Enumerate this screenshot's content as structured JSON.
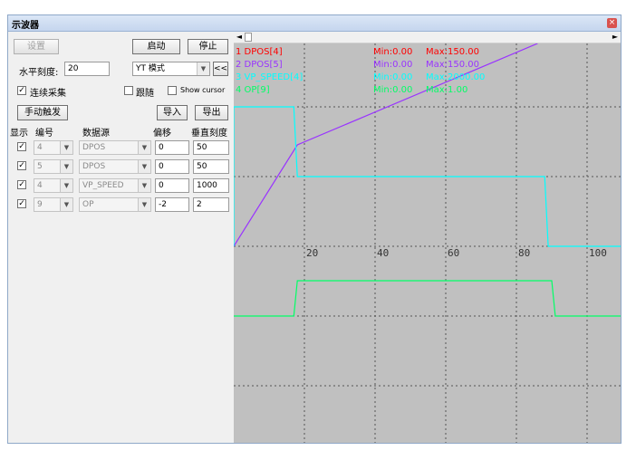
{
  "window": {
    "title": "示波器",
    "close_glyph": "×"
  },
  "toolbar": {
    "settings_label": "设置",
    "start_label": "启动",
    "stop_label": "停止",
    "h_scale_label": "水平刻度:",
    "h_scale_value": "20",
    "mode_value": "YT 模式",
    "collapse_label": "<<",
    "continuous_label": "连续采集",
    "continuous_checked": true,
    "follow_label": "跟随",
    "follow_checked": false,
    "show_cursor_label": "Show cursor",
    "show_cursor_checked": false,
    "manual_trigger_label": "手动触发",
    "import_label": "导入",
    "export_label": "导出"
  },
  "channel_table": {
    "headers": [
      "显示",
      "编号",
      "数据源",
      "偏移",
      "垂直刻度"
    ],
    "rows": [
      {
        "show": true,
        "number": "4",
        "source": "DPOS",
        "offset": "0",
        "scale": "50"
      },
      {
        "show": true,
        "number": "5",
        "source": "DPOS",
        "offset": "0",
        "scale": "50"
      },
      {
        "show": true,
        "number": "4",
        "source": "VP_SPEED",
        "offset": "0",
        "scale": "1000"
      },
      {
        "show": true,
        "number": "9",
        "source": "OP",
        "offset": "-2",
        "scale": "2"
      }
    ]
  },
  "scroll": {
    "left_glyph": "◄",
    "right_glyph": "►"
  },
  "legend": [
    {
      "name": "1 DPOS[4]",
      "min": "Min:0.00",
      "max": "Max:150.00",
      "color": "#ff0000"
    },
    {
      "name": "2 DPOS[5]",
      "min": "Min:0.00",
      "max": "Max:150.00",
      "color": "#9933ff"
    },
    {
      "name": "3 VP_SPEED[4]",
      "min": "Min:0.00",
      "max": "Max:2000.00",
      "color": "#00ffff"
    },
    {
      "name": "4 OP[9]",
      "min": "Min:0.00",
      "max": "Max:1.00",
      "color": "#00ff66"
    }
  ],
  "chart_data": {
    "type": "line",
    "x_ticks": [
      "20",
      "40",
      "60",
      "80",
      "100"
    ],
    "xlim": [
      0,
      100
    ],
    "grid": true,
    "series": [
      {
        "name": "1 DPOS[4]",
        "color": "#ff0000",
        "points": []
      },
      {
        "name": "2 DPOS[5]",
        "color": "#9933ff",
        "points": [
          [
            0,
            0
          ],
          [
            18,
            75
          ],
          [
            86,
            150
          ]
        ]
      },
      {
        "name": "3 VP_SPEED[4]",
        "color": "#00ffff",
        "points": [
          [
            0,
            0
          ],
          [
            0,
            2000
          ],
          [
            17,
            2000
          ],
          [
            18,
            1000
          ],
          [
            88,
            1000
          ],
          [
            89,
            0
          ],
          [
            110,
            0
          ]
        ]
      },
      {
        "name": "4 OP[9]",
        "color": "#00ff66",
        "points": [
          [
            0,
            0
          ],
          [
            17,
            0
          ],
          [
            18,
            1
          ],
          [
            90,
            1
          ],
          [
            91,
            0
          ],
          [
            110,
            0
          ]
        ]
      }
    ]
  }
}
